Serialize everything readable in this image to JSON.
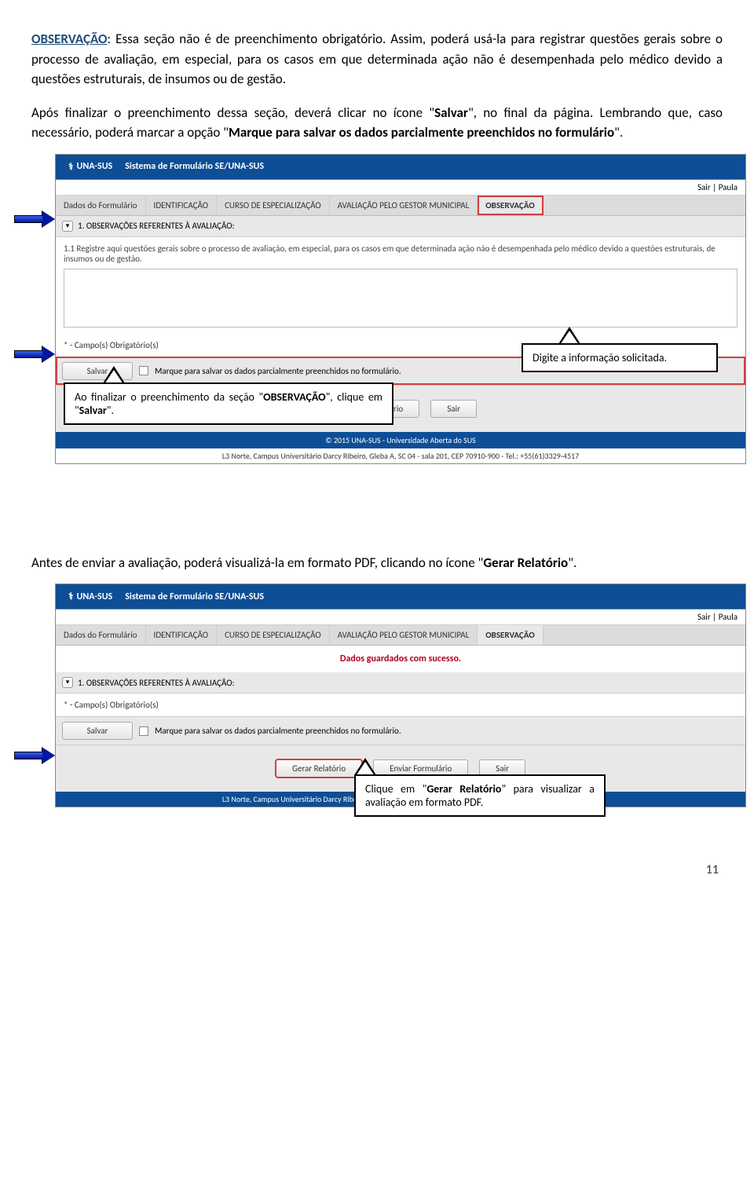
{
  "intro": {
    "title_link": "OBSERVAÇÃO",
    "after_title": ": Essa seção não é de preenchimento obrigatório. Assim, poderá usá-la para registrar questões gerais sobre o processo de avaliação, em especial, para os casos em que determinada ação não é desempenhada pelo médico devido a questões estruturais, de insumos ou de gestão."
  },
  "para2": {
    "part1": "Após finalizar o preenchimento dessa seção, deverá clicar no ícone \"",
    "bold1": "Salvar",
    "part2": "\", no final da página. Lembrando que, caso necessário, poderá marcar a opção \"",
    "bold2": "Marque para salvar os dados parcialmente preenchidos no formulário",
    "part3": "\"."
  },
  "ss1": {
    "brand_icon": "⚕",
    "brand": "UNA-SUS",
    "header_title": "Sistema de Formulário SE/UNA-SUS",
    "topright_sair": "Sair",
    "topright_user": "Paula",
    "tabs": {
      "dados": "Dados do Formulário",
      "ident": "IDENTIFICAÇÃO",
      "curso": "CURSO DE ESPECIALIZAÇÃO",
      "aval": "AVALIAÇÃO PELO GESTOR MUNICIPAL",
      "obs": "OBSERVAÇÃO"
    },
    "expander_label": "1. OBSERVAÇÕES REFERENTES À AVALIAÇÃO:",
    "body_text": "1.1 Registre aqui questões gerais sobre o processo de avaliação, em especial, para os casos em que determinada ação não é desempenhada pelo médico devido a questões estruturais, de insumos ou de gestão.",
    "required_note": "* - Campo(s) Obrigatório(s)",
    "save_btn": "Salvar",
    "checkbox_label": "Marque para salvar os dados parcialmente preenchidos no formulário.",
    "btn_enviar": "Enviar Formulário",
    "btn_sair": "Sair",
    "footer_copy": "© 2015 UNA-SUS - Universidade Aberta do SUS",
    "footer_addr": "L3 Norte, Campus Universitário Darcy Ribeiro, Gleba A, SC 04 - sala 201, CEP 70910-900 - Tel.: +55(61)3329-4517",
    "callout_right": "Digite a informação solicitada.",
    "callout_left_p1": "Ao finalizar o preenchimento da seção \"",
    "callout_left_b1": "OBSERVAÇÃO",
    "callout_left_p2": "\", clique em \"",
    "callout_left_b2": "Salvar",
    "callout_left_p3": "\"."
  },
  "para3": {
    "part1": "Antes de enviar a avaliação, poderá visualizá-la em formato PDF, clicando no ícone \"",
    "bold1": "Gerar Relatório",
    "part2": "\"."
  },
  "ss2": {
    "success": "Dados guardados com sucesso.",
    "btn_gerar": "Gerar Relatório",
    "callout_p1": "Clique em \"",
    "callout_b1": "Gerar Relatório",
    "callout_p2": "\" para visualizar a avaliação em formato PDF."
  },
  "page_number": "11"
}
